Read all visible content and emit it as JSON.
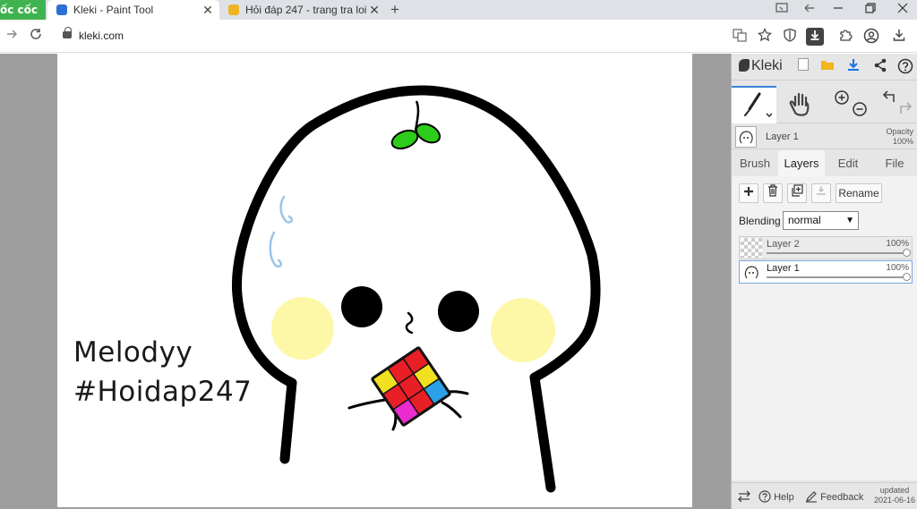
{
  "browser": {
    "brand": "ốc cốc",
    "tabs": [
      {
        "title": "Kleki - Paint Tool",
        "active": true
      },
      {
        "title": "Hỏi đáp 247 - trang tra loi",
        "active": false
      }
    ],
    "new_tab": "+",
    "close_glyph": "✕",
    "url": "kleki.com"
  },
  "canvas": {
    "signature_line1": "Melodyy",
    "signature_line2": "#Hoidap247",
    "colors": {
      "outline": "#000000",
      "sprout": "#2ecc1a",
      "cheeks": "#fdf7a8",
      "sweat": "#9cc4e8"
    }
  },
  "panel": {
    "logo": "Kleki",
    "current_layer": {
      "name": "Layer 1",
      "opacity_label": "Opacity",
      "opacity_value": "100%"
    },
    "tabs": [
      "Brush",
      "Layers",
      "Edit",
      "File"
    ],
    "active_tab": "Layers",
    "buttons": {
      "rename": "Rename"
    },
    "blending": {
      "label": "Blending",
      "value": "normal"
    },
    "layers": [
      {
        "name": "Layer 2",
        "opacity": "100%",
        "selected": false
      },
      {
        "name": "Layer 1",
        "opacity": "100%",
        "selected": true
      }
    ],
    "footer": {
      "help": "Help",
      "feedback": "Feedback",
      "updated_label": "updated",
      "updated_date": "2021-06-16"
    },
    "accent": "#3c84d8"
  }
}
